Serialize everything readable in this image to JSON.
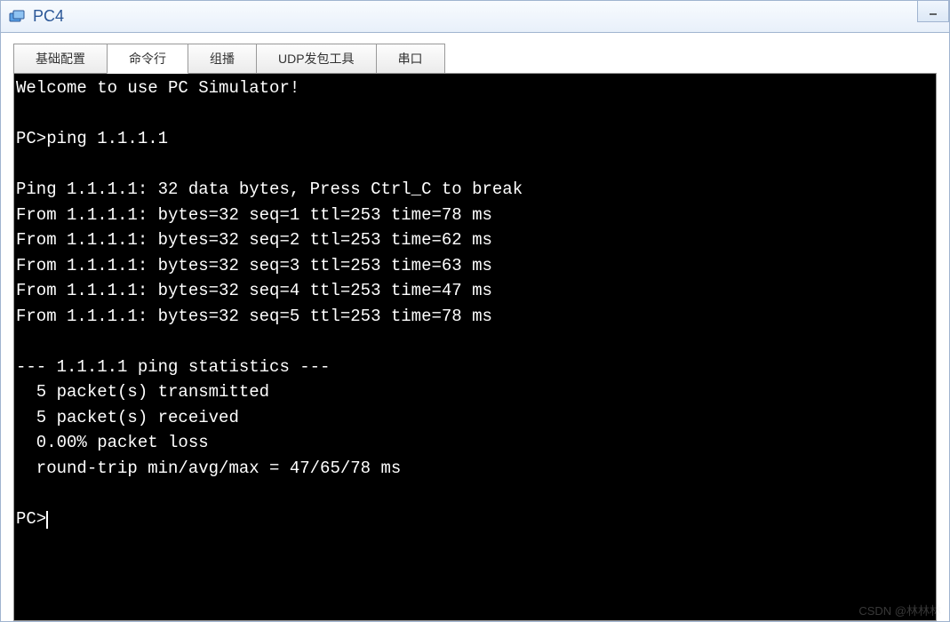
{
  "window": {
    "title": "PC4"
  },
  "tabs": [
    {
      "label": "基础配置",
      "active": false
    },
    {
      "label": "命令行",
      "active": true
    },
    {
      "label": "组播",
      "active": false
    },
    {
      "label": "UDP发包工具",
      "active": false
    },
    {
      "label": "串口",
      "active": false
    }
  ],
  "terminal": {
    "lines": [
      "Welcome to use PC Simulator!",
      "",
      "PC>ping 1.1.1.1",
      "",
      "Ping 1.1.1.1: 32 data bytes, Press Ctrl_C to break",
      "From 1.1.1.1: bytes=32 seq=1 ttl=253 time=78 ms",
      "From 1.1.1.1: bytes=32 seq=2 ttl=253 time=62 ms",
      "From 1.1.1.1: bytes=32 seq=3 ttl=253 time=63 ms",
      "From 1.1.1.1: bytes=32 seq=4 ttl=253 time=47 ms",
      "From 1.1.1.1: bytes=32 seq=5 ttl=253 time=78 ms",
      "",
      "--- 1.1.1.1 ping statistics ---",
      "  5 packet(s) transmitted",
      "  5 packet(s) received",
      "  0.00% packet loss",
      "  round-trip min/avg/max = 47/65/78 ms",
      "",
      "PC>"
    ],
    "prompt_has_cursor": true
  },
  "watermark": "CSDN @林林林"
}
